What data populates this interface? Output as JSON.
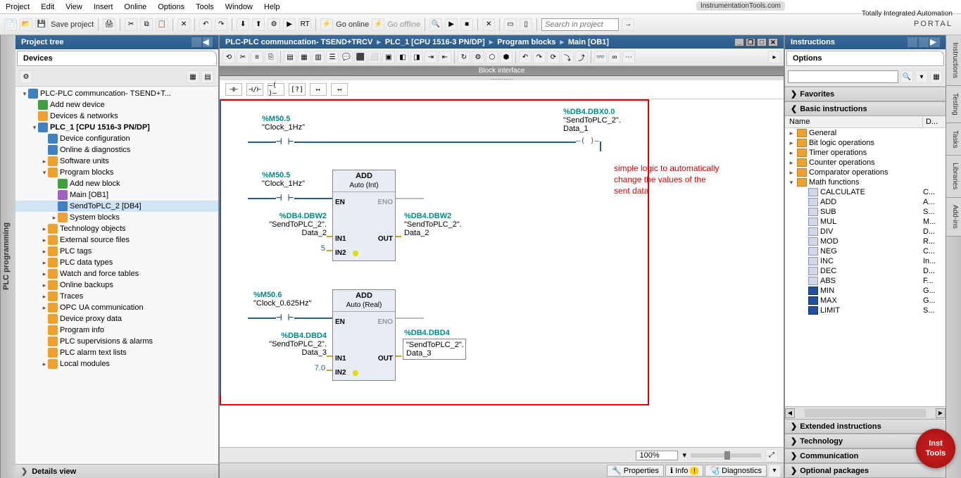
{
  "menu": [
    "Project",
    "Edit",
    "View",
    "Insert",
    "Online",
    "Options",
    "Tools",
    "Window",
    "Help"
  ],
  "brand_watermark": "InstrumentationTools.com",
  "portal_top": "Totally Integrated Automation",
  "portal_bottom": "PORTAL",
  "toolbar": {
    "save_label": "Save project",
    "go_online": "Go online",
    "go_offline": "Go offline",
    "search_placeholder": "Search in project"
  },
  "project_tree": {
    "title": "Project tree",
    "devices": "Devices",
    "details": "Details view",
    "nodes": [
      {
        "d": 0,
        "exp": "▾",
        "icon": "blue",
        "label": "PLC-PLC communcation- TSEND+T..."
      },
      {
        "d": 1,
        "exp": "",
        "icon": "green",
        "label": "Add new device"
      },
      {
        "d": 1,
        "exp": "",
        "icon": "orange",
        "label": "Devices & networks"
      },
      {
        "d": 1,
        "exp": "▾",
        "icon": "blue",
        "label": "PLC_1 [CPU 1516-3 PN/DP]",
        "bold": true
      },
      {
        "d": 2,
        "exp": "",
        "icon": "blue",
        "label": "Device configuration"
      },
      {
        "d": 2,
        "exp": "",
        "icon": "blue",
        "label": "Online & diagnostics"
      },
      {
        "d": 2,
        "exp": "▸",
        "icon": "orange",
        "label": "Software units"
      },
      {
        "d": 2,
        "exp": "▾",
        "icon": "orange",
        "label": "Program blocks"
      },
      {
        "d": 3,
        "exp": "",
        "icon": "green",
        "label": "Add new block"
      },
      {
        "d": 3,
        "exp": "",
        "icon": "purple",
        "label": "Main [OB1]"
      },
      {
        "d": 3,
        "exp": "",
        "icon": "blue",
        "label": "SendToPLC_2 [DB4]",
        "sel": true
      },
      {
        "d": 3,
        "exp": "▸",
        "icon": "orange",
        "label": "System blocks"
      },
      {
        "d": 2,
        "exp": "▸",
        "icon": "orange",
        "label": "Technology objects"
      },
      {
        "d": 2,
        "exp": "▸",
        "icon": "orange",
        "label": "External source files"
      },
      {
        "d": 2,
        "exp": "▸",
        "icon": "orange",
        "label": "PLC tags"
      },
      {
        "d": 2,
        "exp": "▸",
        "icon": "orange",
        "label": "PLC data types"
      },
      {
        "d": 2,
        "exp": "▸",
        "icon": "orange",
        "label": "Watch and force tables"
      },
      {
        "d": 2,
        "exp": "▸",
        "icon": "orange",
        "label": "Online backups"
      },
      {
        "d": 2,
        "exp": "▸",
        "icon": "orange",
        "label": "Traces"
      },
      {
        "d": 2,
        "exp": "▸",
        "icon": "orange",
        "label": "OPC UA communication"
      },
      {
        "d": 2,
        "exp": "",
        "icon": "orange",
        "label": "Device proxy data"
      },
      {
        "d": 2,
        "exp": "",
        "icon": "orange",
        "label": "Program info"
      },
      {
        "d": 2,
        "exp": "",
        "icon": "orange",
        "label": "PLC supervisions & alarms"
      },
      {
        "d": 2,
        "exp": "",
        "icon": "orange",
        "label": "PLC alarm text lists"
      },
      {
        "d": 2,
        "exp": "▸",
        "icon": "orange",
        "label": "Local modules"
      }
    ]
  },
  "side_tab_left": "PLC programming",
  "breadcrumb": [
    "PLC-PLC communcation- TSEND+TRCV",
    "PLC_1 [CPU 1516-3 PN/DP]",
    "Program blocks",
    "Main [OB1]"
  ],
  "block_interface": "Block interface",
  "ladder": {
    "rung1": {
      "in_addr": "%M50.5",
      "in_name": "\"Clock_1Hz\"",
      "out_addr": "%DB4.DBX0.0",
      "out_name1": "\"SendToPLC_2\".",
      "out_name2": "Data_1"
    },
    "rung2": {
      "in_addr": "%M50.5",
      "in_name": "\"Clock_1Hz\"",
      "box_title": "ADD",
      "box_sub": "Auto (Int)",
      "in1_addr": "%DB4.DBW2",
      "in1_name1": "\"SendToPLC_2\".",
      "in1_name2": "Data_2",
      "in2_val": "5",
      "out_addr": "%DB4.DBW2",
      "out_name1": "\"SendToPLC_2\".",
      "out_name2": "Data_2",
      "en": "EN",
      "eno": "ENO",
      "in1": "IN1",
      "in2": "IN2",
      "out": "OUT"
    },
    "rung3": {
      "in_addr": "%M50.6",
      "in_name": "\"Clock_0.625Hz\"",
      "box_title": "ADD",
      "box_sub": "Auto (Real)",
      "in1_addr": "%DB4.DBD4",
      "in1_name1": "\"SendToPLC_2\".",
      "in1_name2": "Data_3",
      "in2_val": "7.0",
      "out_addr": "%DB4.DBD4",
      "out_name1": "\"SendToPLC_2\".",
      "out_name2": "Data_3",
      "en": "EN",
      "eno": "ENO",
      "in1": "IN1",
      "in2": "IN2",
      "out": "OUT"
    },
    "annotation": "simple logic to automatically\nchange the values of the\nsent data"
  },
  "zoom": "100%",
  "footer_tabs": {
    "properties": "Properties",
    "info": "Info",
    "diagnostics": "Diagnostics"
  },
  "instructions": {
    "title": "Instructions",
    "options": "Options",
    "favorites": "Favorites",
    "basic": "Basic instructions",
    "extended": "Extended instructions",
    "technology": "Technology",
    "communication": "Communication",
    "optional": "Optional packages",
    "col_name": "Name",
    "col_d": "D...",
    "groups": [
      {
        "exp": "▸",
        "icon": "orange",
        "label": "General"
      },
      {
        "exp": "▸",
        "icon": "orange",
        "label": "Bit logic operations"
      },
      {
        "exp": "▸",
        "icon": "orange",
        "label": "Timer operations"
      },
      {
        "exp": "▸",
        "icon": "orange",
        "label": "Counter operations"
      },
      {
        "exp": "▸",
        "icon": "orange",
        "label": "Comparator operations"
      },
      {
        "exp": "▾",
        "icon": "orange",
        "label": "Math functions"
      }
    ],
    "math": [
      {
        "icon": "fn",
        "label": "CALCULATE",
        "d": "C..."
      },
      {
        "icon": "fn",
        "label": "ADD",
        "d": "A..."
      },
      {
        "icon": "fn",
        "label": "SUB",
        "d": "S..."
      },
      {
        "icon": "fn",
        "label": "MUL",
        "d": "M..."
      },
      {
        "icon": "fn",
        "label": "DIV",
        "d": "D..."
      },
      {
        "icon": "fn",
        "label": "MOD",
        "d": "R..."
      },
      {
        "icon": "fn",
        "label": "NEG",
        "d": "C..."
      },
      {
        "icon": "fn",
        "label": "INC",
        "d": "In..."
      },
      {
        "icon": "fn",
        "label": "DEC",
        "d": "D..."
      },
      {
        "icon": "fn",
        "label": "ABS",
        "d": "F..."
      },
      {
        "icon": "bar",
        "label": "MIN",
        "d": "G..."
      },
      {
        "icon": "bar",
        "label": "MAX",
        "d": "G..."
      },
      {
        "icon": "bar",
        "label": "LIMIT",
        "d": "S..."
      }
    ]
  },
  "vtabs": [
    "Instructions",
    "Testing",
    "Tasks",
    "Libraries",
    "Add-ins"
  ],
  "inst_tools": {
    "l1": "Inst",
    "l2": "Tools"
  }
}
